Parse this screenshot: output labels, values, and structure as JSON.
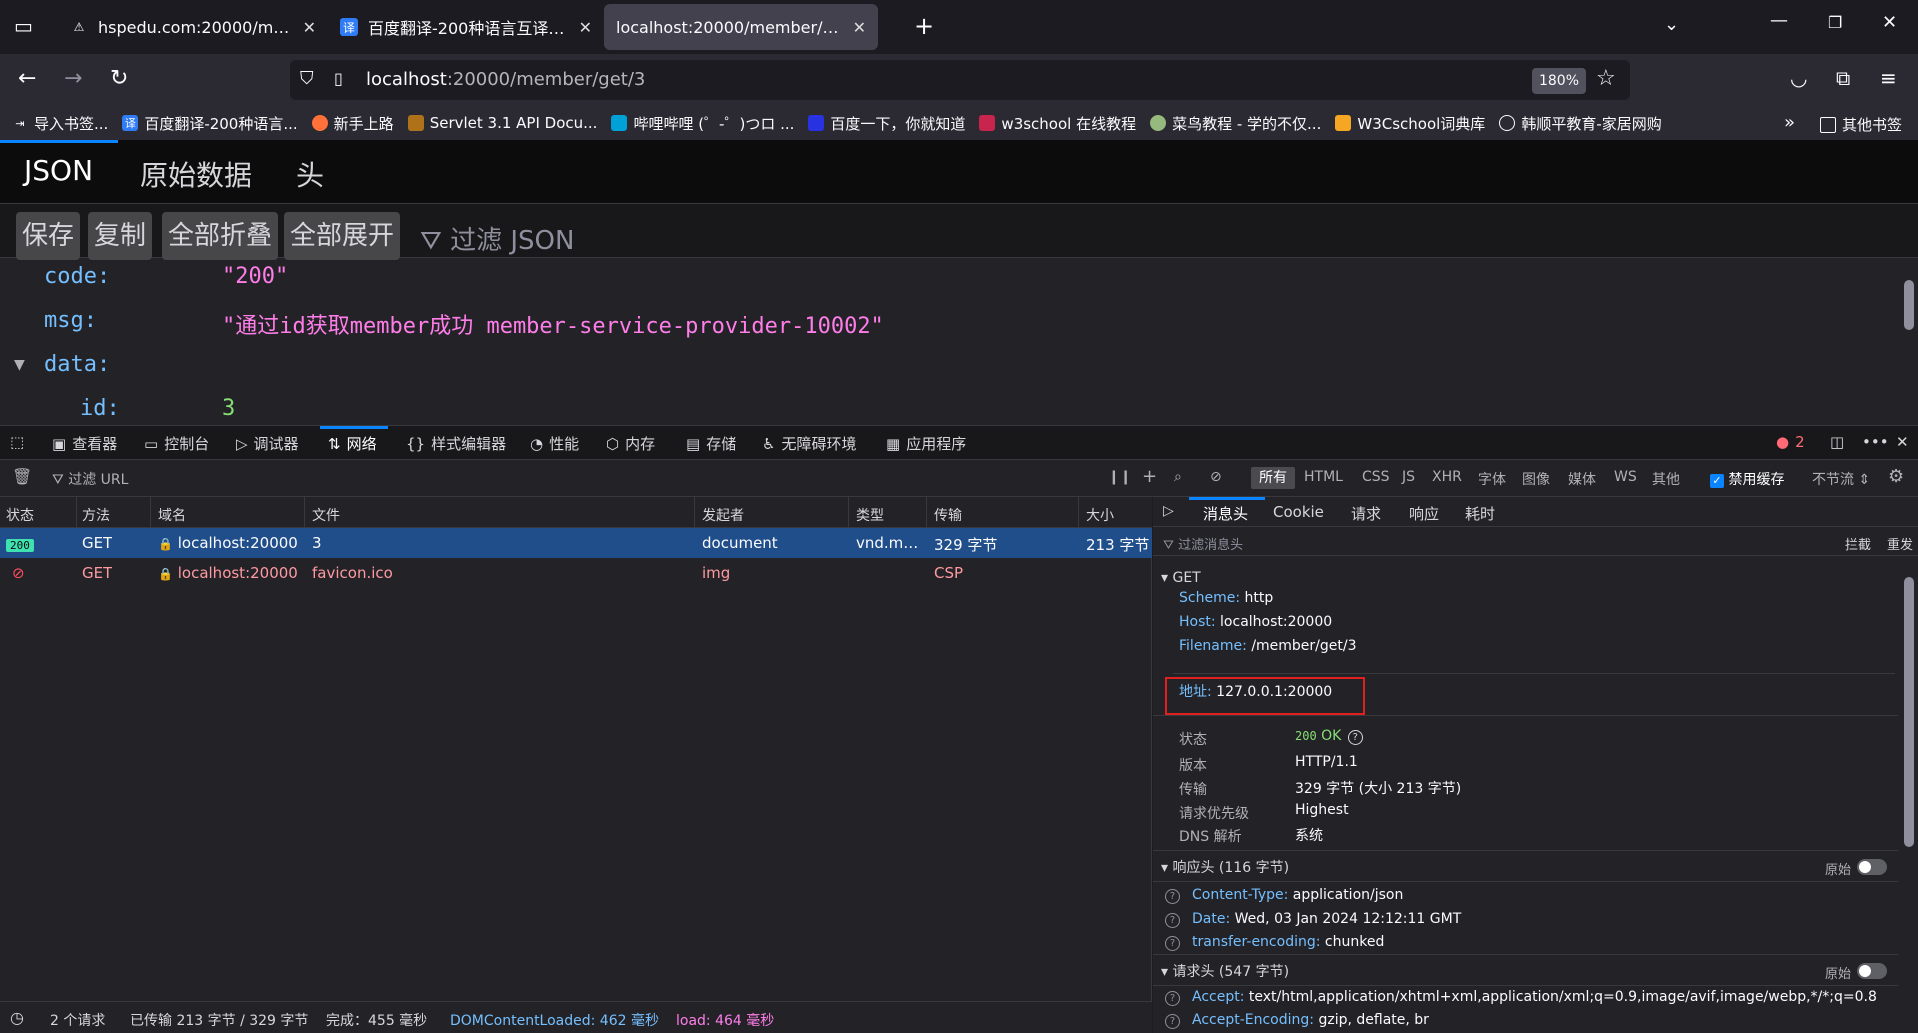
{
  "tabs": [
    {
      "title": "hspedu.com:20000/member/",
      "icon": "warning-icon",
      "active": false
    },
    {
      "title": "百度翻译-200种语言互译、沟通",
      "icon": "translate-icon",
      "icon_glyph": "译",
      "active": false
    },
    {
      "title": "localhost:20000/member/get/3",
      "icon": "",
      "active": true
    }
  ],
  "navbar": {
    "url_host": "localhost",
    "url_rest": ":20000/member/get/3",
    "zoom": "180%"
  },
  "bookmarks": [
    {
      "label": "导入书签...",
      "icon": "import-icon",
      "color": "#2b2a33"
    },
    {
      "label": "百度翻译-200种语言...",
      "icon": "translate-icon",
      "color": "#2f7cf6",
      "glyph": "译"
    },
    {
      "label": "新手上路",
      "icon": "firefox-icon",
      "color": "#ff7139"
    },
    {
      "label": "Servlet 3.1 API Docu...",
      "icon": "java-doc-icon",
      "color": "#b07219"
    },
    {
      "label": "哔哩哔哩 (゜-゜)つロ ...",
      "icon": "bilibili-icon",
      "color": "#00a1d6"
    },
    {
      "label": "百度一下，你就知道",
      "icon": "baidu-icon",
      "color": "#2932e1"
    },
    {
      "label": "w3school 在线教程",
      "icon": "w3school-icon",
      "color": "#c7254e"
    },
    {
      "label": "菜鸟教程 - 学的不仅...",
      "icon": "runoob-icon",
      "color": "#96b97d"
    },
    {
      "label": "W3Cschool词典库",
      "icon": "w3cschool-icon",
      "color": "#f5a623"
    },
    {
      "label": "韩顺平教育-家居网购",
      "icon": "globe-icon",
      "color": "#2b2a33"
    }
  ],
  "bookmarks_more": "其他书签",
  "json_viewer": {
    "tabs": [
      "JSON",
      "原始数据",
      "头"
    ],
    "buttons": [
      "保存",
      "复制",
      "全部折叠",
      "全部展开"
    ],
    "filter_placeholder": "过滤 JSON",
    "rows": [
      {
        "key": "code:",
        "value": "\"200\""
      },
      {
        "key": "msg:",
        "value": "\"通过id获取member成功 member-service-provider-10002\""
      },
      {
        "key": "data:",
        "value": ""
      },
      {
        "key": "id:",
        "value": "3"
      }
    ]
  },
  "devtools": {
    "tabs": [
      "查看器",
      "控制台",
      "调试器",
      "网络",
      "样式编辑器",
      "性能",
      "内存",
      "存储",
      "无障碍环境",
      "应用程序"
    ],
    "error_count": "2",
    "filter_url_placeholder": "过滤 URL",
    "type_filters": [
      "所有",
      "HTML",
      "CSS",
      "JS",
      "XHR",
      "字体",
      "图像",
      "媒体",
      "WS",
      "其他"
    ],
    "disable_cache": "禁用缓存",
    "throttle": "不节流",
    "columns": [
      "状态",
      "方法",
      "域名",
      "文件",
      "发起者",
      "类型",
      "传输",
      "大小"
    ],
    "requests": [
      {
        "status": "200",
        "method": "GET",
        "domain": "localhost:20000",
        "file": "3",
        "initiator": "document",
        "type": "vnd.mo...",
        "transfer": "329 字节",
        "size": "213 字节"
      },
      {
        "status": "",
        "method": "GET",
        "domain": "localhost:20000",
        "file": "favicon.ico",
        "initiator": "img",
        "type": "",
        "transfer": "CSP",
        "size": ""
      }
    ],
    "statusbar": {
      "requests": "2 个请求",
      "transferred": "已传输 213 字节 / 329 字节",
      "finish": "完成：455 毫秒",
      "dcl": "DOMContentLoaded: 462 毫秒",
      "load": "load: 464 毫秒"
    },
    "details": {
      "tabs": [
        "消息头",
        "Cookie",
        "请求",
        "响应",
        "耗时"
      ],
      "filter_placeholder": "过滤消息头",
      "block": "拦截",
      "resend": "重发",
      "get_label": "GET",
      "scheme_label": "Scheme:",
      "scheme": "http",
      "host_label": "Host:",
      "host": "localhost:20000",
      "filename_label": "Filename:",
      "filename": "/member/get/3",
      "address_label": "地址:",
      "address": "127.0.0.1:20000",
      "status_label": "状态",
      "status_code": "200",
      "status_text": "OK",
      "version_label": "版本",
      "version": "HTTP/1.1",
      "transfer_label": "传输",
      "transfer": "329 字节 (大小 213 字节)",
      "priority_label": "请求优先级",
      "priority": "Highest",
      "dns_label": "DNS 解析",
      "dns": "系统",
      "response_headers": "响应头 (116 字节)",
      "raw": "原始",
      "resp": [
        {
          "name": "Content-Type:",
          "value": "application/json"
        },
        {
          "name": "Date:",
          "value": "Wed, 03 Jan 2024 12:12:11 GMT"
        },
        {
          "name": "transfer-encoding:",
          "value": "chunked"
        }
      ],
      "request_headers": "请求头 (547 字节)",
      "req": [
        {
          "name": "Accept:",
          "value": "text/html,application/xhtml+xml,application/xml;q=0.9,image/avif,image/webp,*/*;q=0.8"
        },
        {
          "name": "Accept-Encoding:",
          "value": "gzip, deflate, br"
        }
      ]
    }
  }
}
